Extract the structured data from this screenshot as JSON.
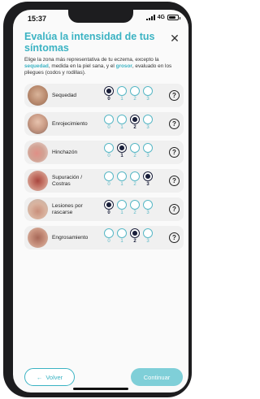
{
  "status_bar": {
    "time": "15:37",
    "network": "4G"
  },
  "header": {
    "title": "Evalúa la intensidad de tus síntomas",
    "close_icon": "close-icon"
  },
  "intro": {
    "part1": "Elige la zona más representativa de tu eczema, excepto la ",
    "highlight1": "sequedad",
    "part2": ", medida en la piel sana, y el ",
    "highlight2": "grosor",
    "part3": ", evaluado en los pliegues (codos y rodillas)."
  },
  "scale_labels": [
    "0",
    "1",
    "2",
    "3"
  ],
  "symptoms": [
    {
      "label": "Sequedad",
      "selected": 0
    },
    {
      "label": "Enrojecimiento",
      "selected": 2
    },
    {
      "label": "Hinchazón",
      "selected": 1
    },
    {
      "label": "Supuración / Costras",
      "selected": 3
    },
    {
      "label": "Lesiones por rascarse",
      "selected": 0
    },
    {
      "label": "Engrosamiento",
      "selected": 2
    }
  ],
  "help_label": "?",
  "footer": {
    "back_label": "Volver",
    "back_icon": "arrow-left-icon",
    "continue_label": "Continuar"
  },
  "colors": {
    "accent": "#3bb3c3",
    "selected": "#1a1f3a",
    "continue_bg": "#7fcfd8"
  }
}
